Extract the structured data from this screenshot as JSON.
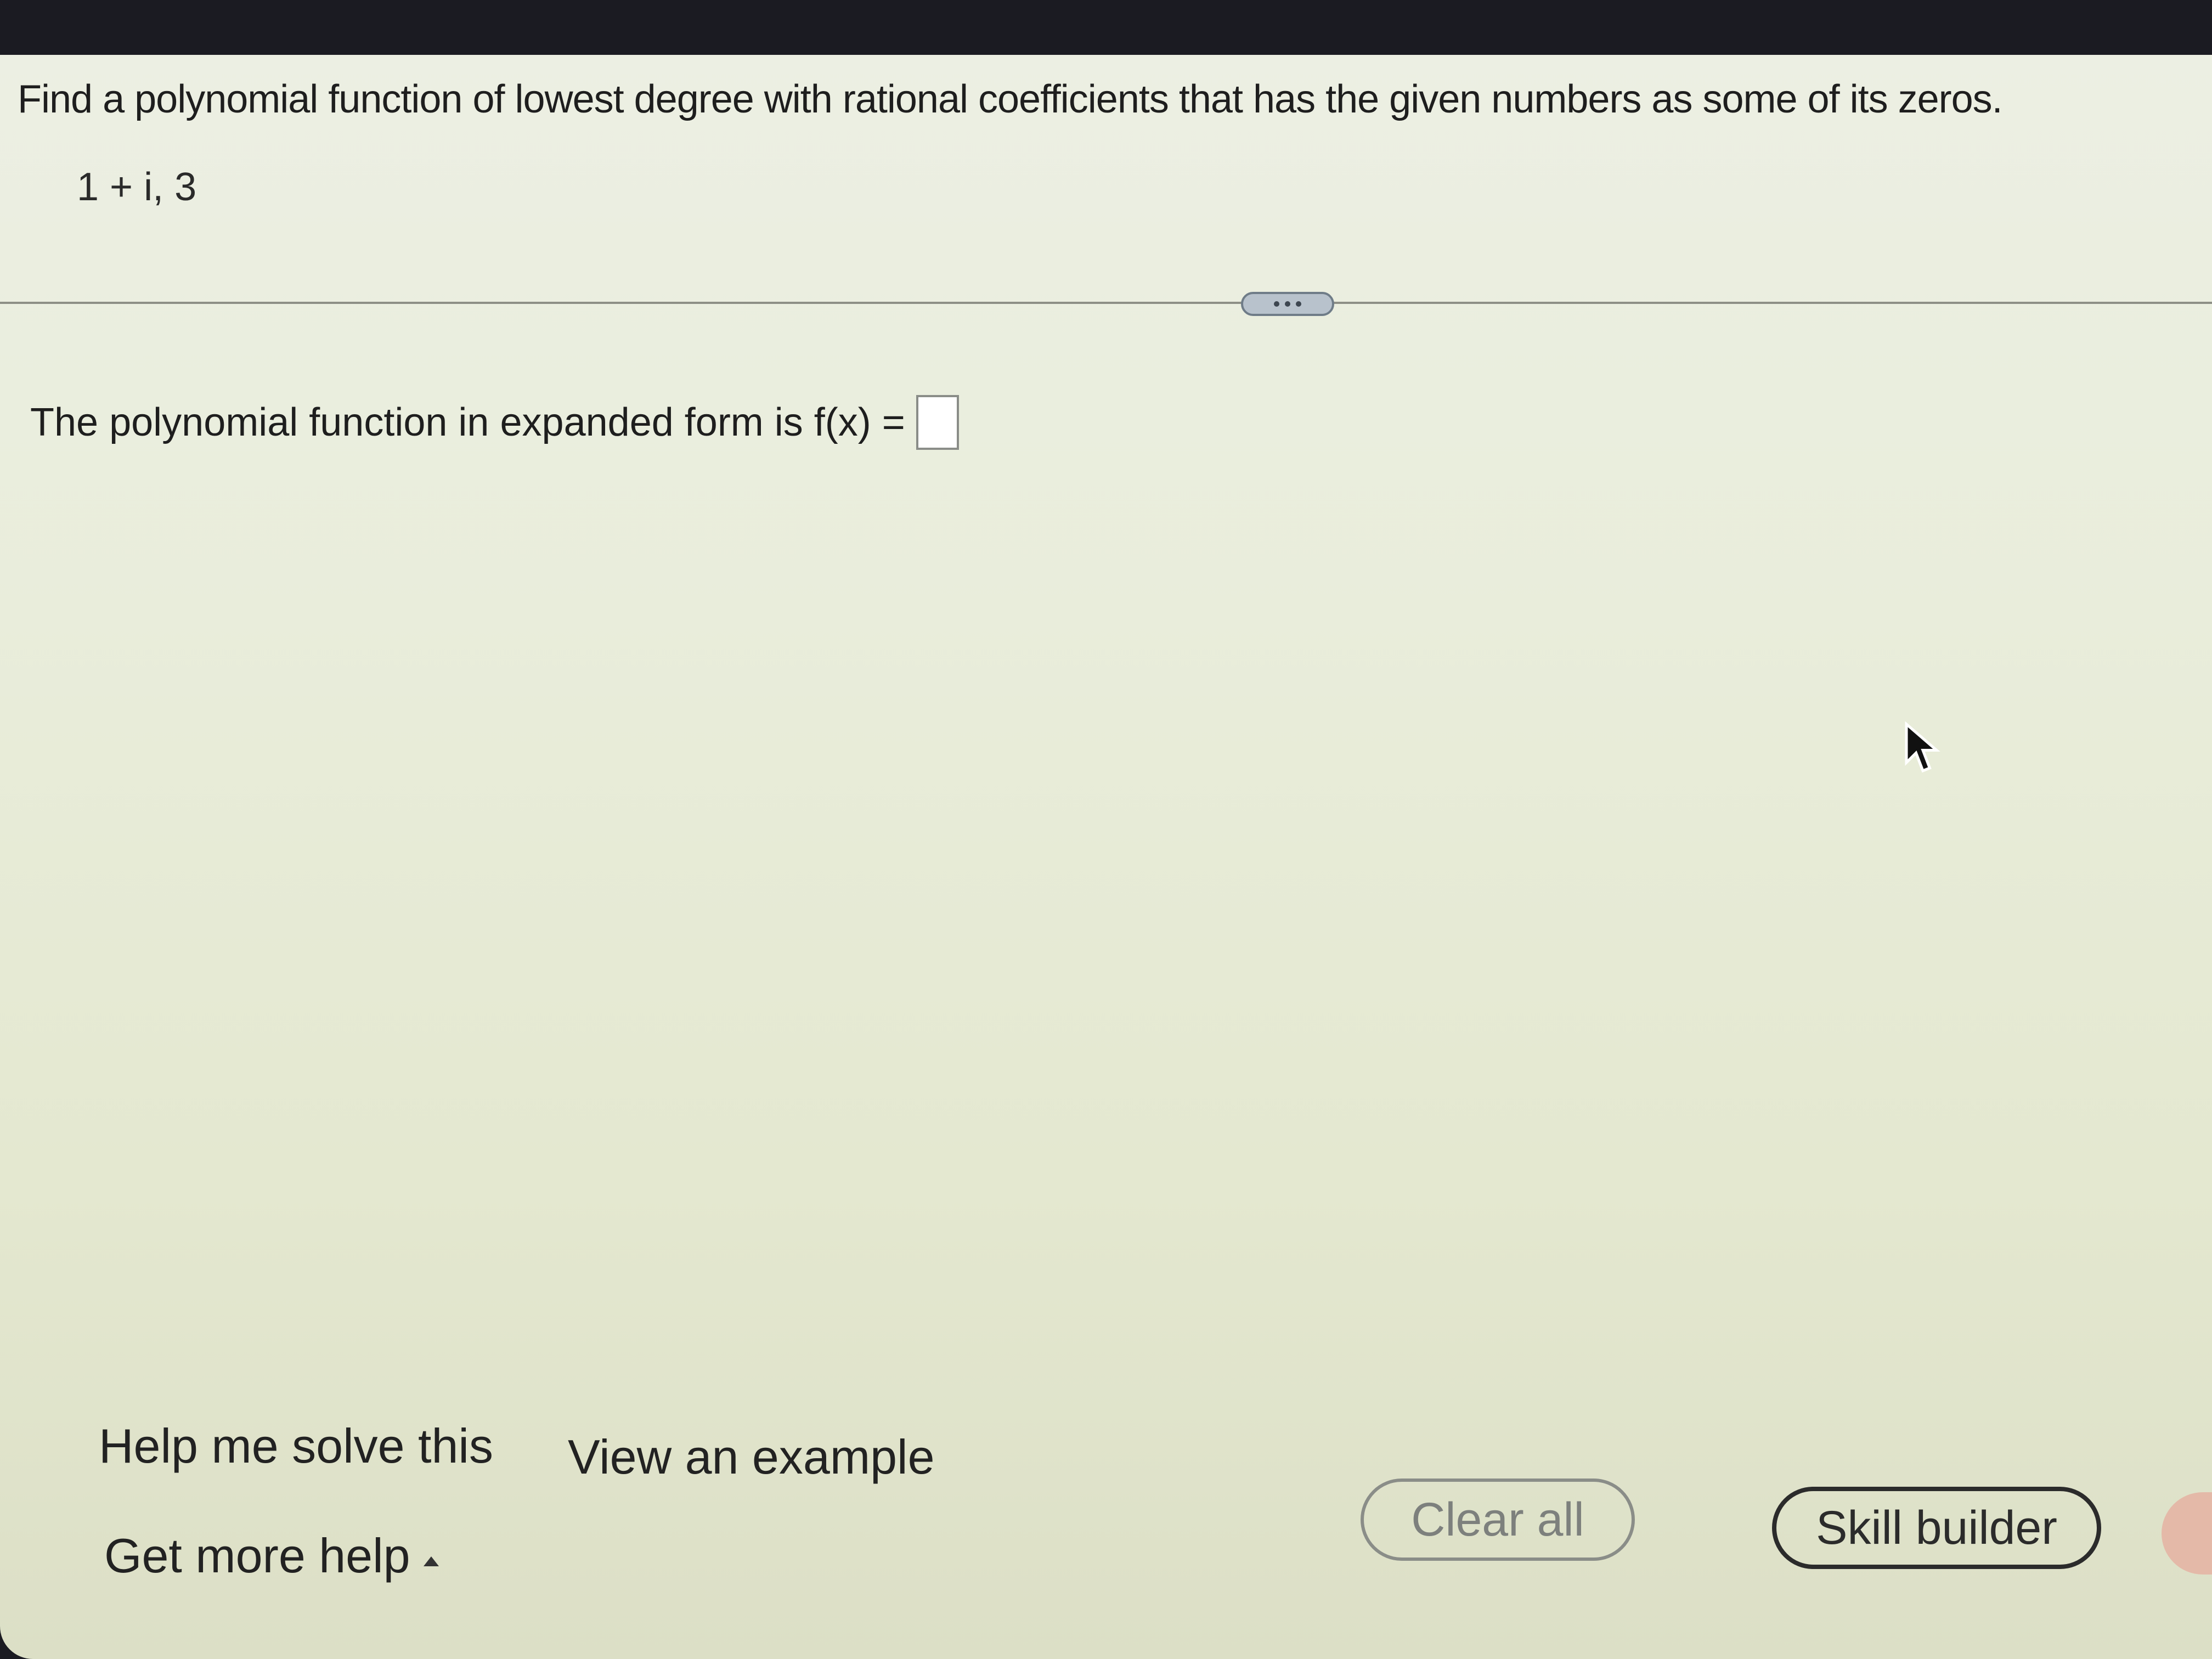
{
  "question": {
    "text": "Find a polynomial function of lowest degree with rational coefficients that has the given numbers as some of its zeros.",
    "zeros": "1 + i, 3"
  },
  "answer": {
    "prompt": "The polynomial function in expanded form is f(x) ="
  },
  "divider": {
    "handle_icon": "ellipsis-icon"
  },
  "help": {
    "help_me_solve": "Help me solve this",
    "view_example": "View an example",
    "get_more_help": "Get more help"
  },
  "buttons": {
    "clear_all": "Clear all",
    "skill_builder": "Skill builder"
  }
}
